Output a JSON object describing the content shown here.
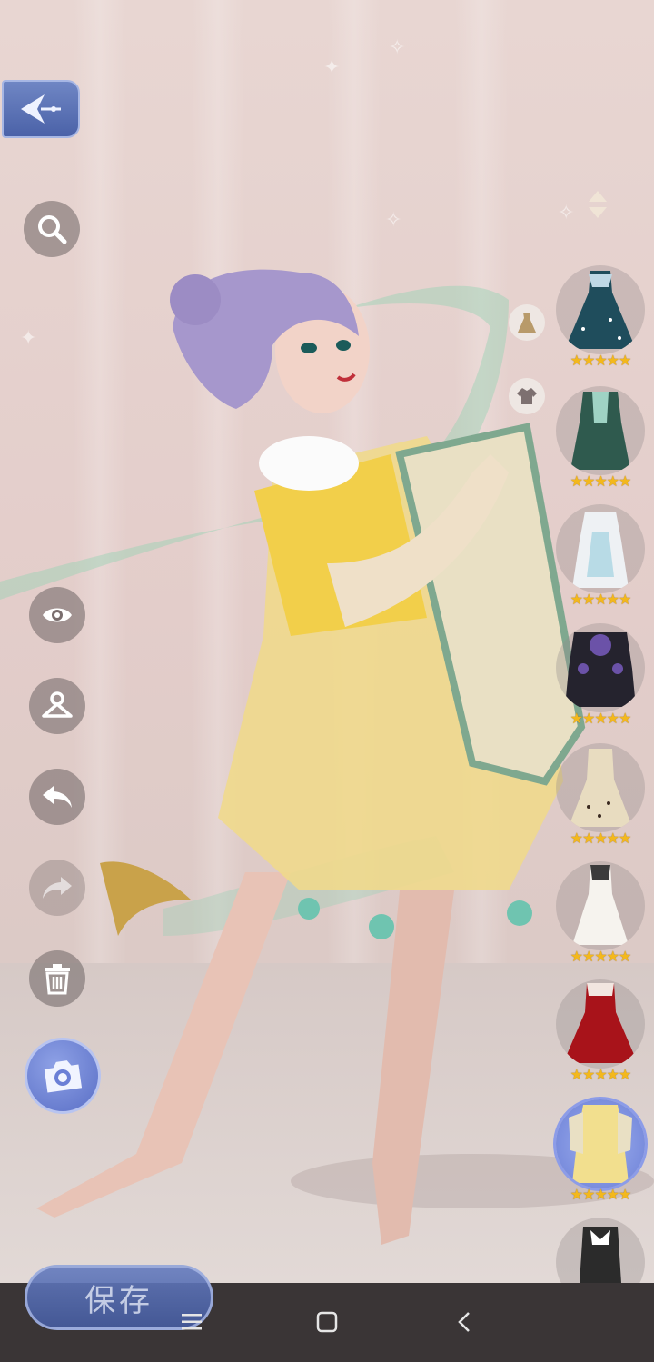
{
  "toolbar": {
    "back": "back-arrow-icon",
    "search": "search-icon",
    "visibility": "eye-icon",
    "hanger": "hanger-icon",
    "undo": "undo-icon",
    "redo": "redo-icon",
    "delete": "trash-icon",
    "camera": "camera-icon"
  },
  "sort_icon": "sort-icon",
  "category_icons": [
    "dress-category-icon",
    "top-category-icon"
  ],
  "outfits": [
    {
      "name": "teal-starry-gown",
      "stars": "★★★★★",
      "rating": 5
    },
    {
      "name": "teal-jade-robe",
      "stars": "★★★★★",
      "rating": 5
    },
    {
      "name": "white-blue-dress",
      "stars": "★★★★★",
      "rating": 5
    },
    {
      "name": "purple-black-gown",
      "stars": "★★★★★",
      "rating": 5
    },
    {
      "name": "cream-spotted-dress",
      "stars": "★★★★★",
      "rating": 5
    },
    {
      "name": "white-lace-gown",
      "stars": "★★★★★",
      "rating": 5
    },
    {
      "name": "red-rose-gown",
      "stars": "★★★★★",
      "rating": 5
    },
    {
      "name": "yellow-hanfu-selected",
      "stars": "★★★★★",
      "rating": 5
    },
    {
      "name": "black-white-bow",
      "stars": "",
      "rating": 0
    }
  ],
  "save_button": {
    "label": "保存"
  },
  "nav": [
    "menu-icon",
    "home-icon",
    "back-icon"
  ],
  "colors": {
    "accent": "#5a6fc6",
    "star": "#f3b81c",
    "nav_bar": "#3a3536"
  }
}
